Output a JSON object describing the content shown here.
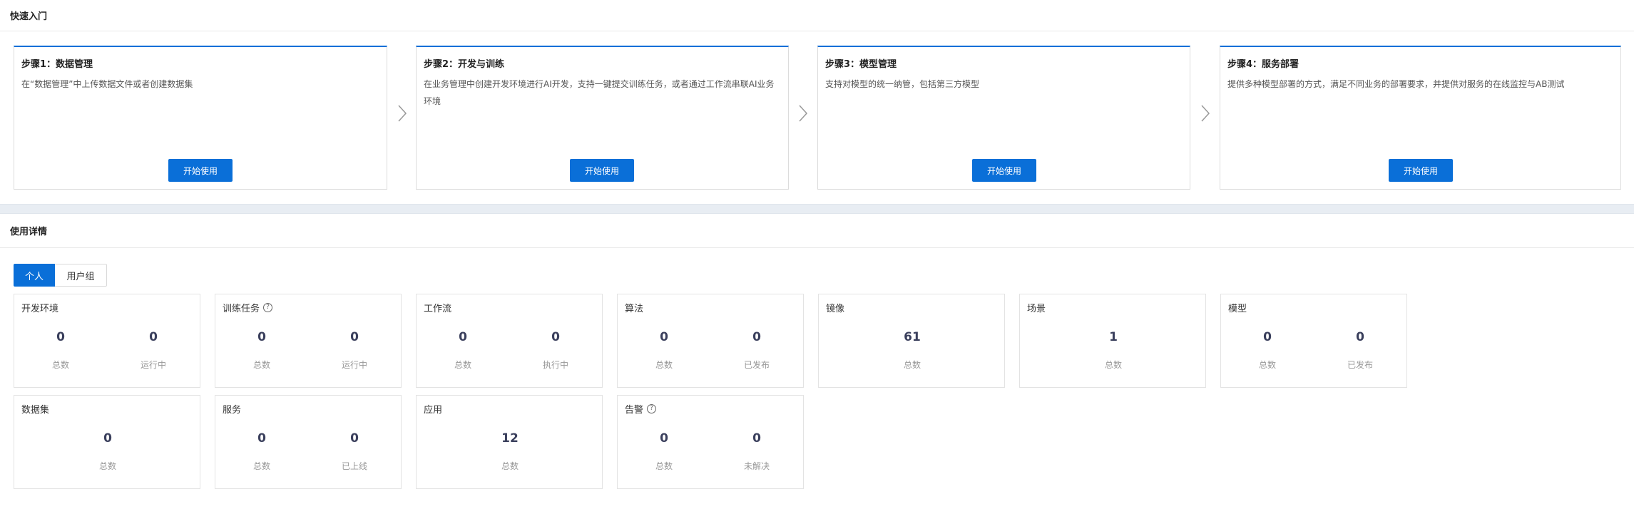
{
  "quick_start": {
    "title": "快速入门",
    "steps": [
      {
        "title": "步骤1：数据管理",
        "desc": "在“数据管理”中上传数据文件或者创建数据集",
        "button": "开始使用"
      },
      {
        "title": "步骤2：开发与训练",
        "desc": "在业务管理中创建开发环境进行AI开发，支持一键提交训练任务，或者通过工作流串联AI业务环境",
        "button": "开始使用"
      },
      {
        "title": "步骤3：模型管理",
        "desc": "支持对模型的统一纳管，包括第三方模型",
        "button": "开始使用"
      },
      {
        "title": "步骤4：服务部署",
        "desc": "提供多种模型部署的方式，满足不同业务的部署要求，并提供对服务的在线监控与AB测试",
        "button": "开始使用"
      }
    ]
  },
  "usage": {
    "title": "使用详情",
    "tabs": [
      "个人",
      "用户组"
    ],
    "active_tab": "个人",
    "cards": [
      {
        "title": "开发环境",
        "metrics": [
          {
            "value": "0",
            "label": "总数"
          },
          {
            "value": "0",
            "label": "运行中"
          }
        ]
      },
      {
        "title": "训练任务",
        "help": true,
        "metrics": [
          {
            "value": "0",
            "label": "总数"
          },
          {
            "value": "0",
            "label": "运行中"
          }
        ]
      },
      {
        "title": "工作流",
        "metrics": [
          {
            "value": "0",
            "label": "总数"
          },
          {
            "value": "0",
            "label": "执行中"
          }
        ]
      },
      {
        "title": "算法",
        "metrics": [
          {
            "value": "0",
            "label": "总数"
          },
          {
            "value": "0",
            "label": "已发布"
          }
        ]
      },
      {
        "title": "镜像",
        "metrics": [
          {
            "value": "61",
            "label": "总数"
          }
        ]
      },
      {
        "title": "场景",
        "metrics": [
          {
            "value": "1",
            "label": "总数"
          }
        ]
      },
      {
        "title": "模型",
        "metrics": [
          {
            "value": "0",
            "label": "总数"
          },
          {
            "value": "0",
            "label": "已发布"
          }
        ]
      },
      {
        "title": "数据集",
        "metrics": [
          {
            "value": "0",
            "label": "总数"
          }
        ]
      },
      {
        "title": "服务",
        "metrics": [
          {
            "value": "0",
            "label": "总数"
          },
          {
            "value": "0",
            "label": "已上线"
          }
        ]
      },
      {
        "title": "应用",
        "metrics": [
          {
            "value": "12",
            "label": "总数"
          }
        ]
      },
      {
        "title": "告警",
        "help": true,
        "metrics": [
          {
            "value": "0",
            "label": "总数"
          },
          {
            "value": "0",
            "label": "未解决"
          }
        ]
      }
    ]
  },
  "icons": {
    "arrow": "chevron-right-icon",
    "help": "question-circle-icon"
  },
  "colors": {
    "primary": "#0a6fd8",
    "value_text": "#3a3f5c",
    "label_text": "#999999",
    "band": "#e8edf3"
  }
}
